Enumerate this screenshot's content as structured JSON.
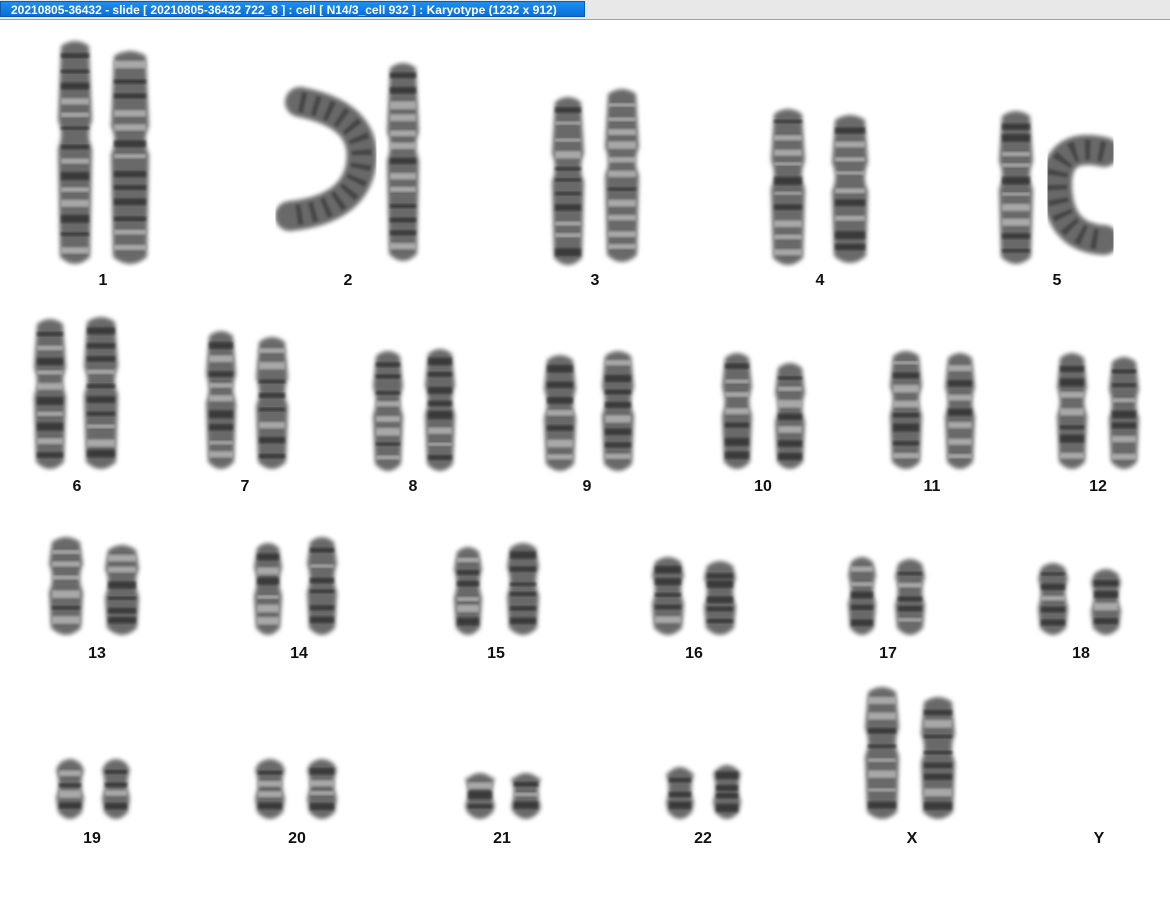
{
  "window": {
    "title": "20210805-36432 - slide [ 20210805-36432 722_8 ] : cell [ N14/3_cell 932 ] : Karyotype  (1232 x 912)"
  },
  "colors": {
    "chromosome": "#4a4a4a",
    "band": "#2a2a2a",
    "background": "#ffffff",
    "title_bar": "#1a7fe8"
  },
  "karyotype": {
    "chromosomes": [
      {
        "label": "1"
      },
      {
        "label": "2"
      },
      {
        "label": "3"
      },
      {
        "label": "4"
      },
      {
        "label": "5"
      },
      {
        "label": "6"
      },
      {
        "label": "7"
      },
      {
        "label": "8"
      },
      {
        "label": "9"
      },
      {
        "label": "10"
      },
      {
        "label": "11"
      },
      {
        "label": "12"
      },
      {
        "label": "13"
      },
      {
        "label": "14"
      },
      {
        "label": "15"
      },
      {
        "label": "16"
      },
      {
        "label": "17"
      },
      {
        "label": "18"
      },
      {
        "label": "19"
      },
      {
        "label": "20"
      },
      {
        "label": "21"
      },
      {
        "label": "22"
      },
      {
        "label": "X"
      },
      {
        "label": "Y"
      }
    ]
  }
}
